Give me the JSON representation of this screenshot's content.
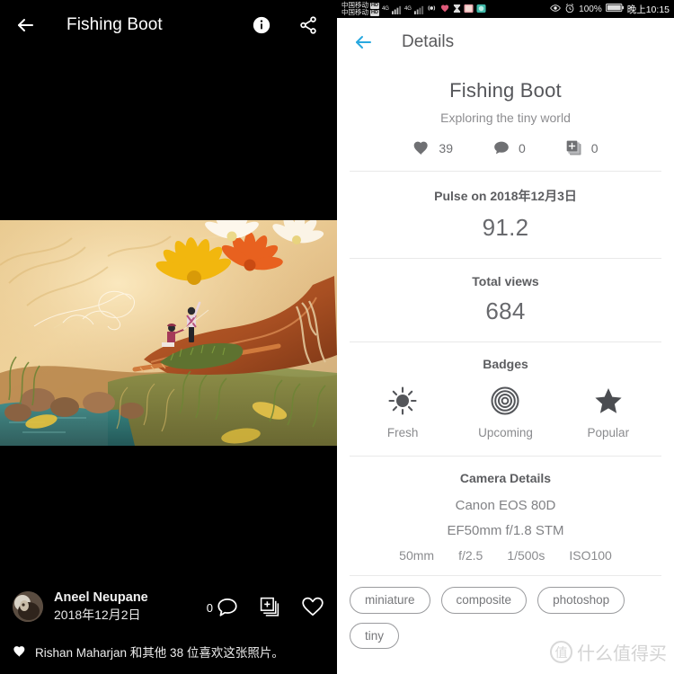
{
  "left": {
    "appbar": {
      "title": "Fishing Boot",
      "back_icon": "arrow-left-icon",
      "info_icon": "info-icon",
      "share_icon": "share-icon"
    },
    "author": {
      "name": "Aneel Neupane",
      "date": "2018年12月2日"
    },
    "actions": {
      "comment_count": "0",
      "comment_icon": "comment-icon",
      "collect_icon": "add-to-collection-icon",
      "like_icon": "heart-outline-icon"
    },
    "likes_text": "Rishan Maharjan 和其他 38 位喜欢这张照片。"
  },
  "statusbar": {
    "carrier_line1": "中国移动",
    "carrier_line2": "中国移动",
    "hd_badge": "HD",
    "net1": "4G",
    "net2": "4G",
    "hotspot": "hotspot-icon",
    "battery_percent": "100%",
    "time": "晚上10:15"
  },
  "details": {
    "appbar": {
      "back_icon": "arrow-left-icon",
      "title": "Details",
      "accent": "#29a8df"
    },
    "hero": {
      "title": "Fishing Boot",
      "subtitle": "Exploring the tiny world",
      "stats": [
        {
          "icon": "heart-filled-icon",
          "value": "39"
        },
        {
          "icon": "comment-filled-icon",
          "value": "0"
        },
        {
          "icon": "add-to-collection-icon",
          "value": "0"
        }
      ]
    },
    "pulse": {
      "label": "Pulse on 2018年12月3日",
      "value": "91.2"
    },
    "views": {
      "label": "Total views",
      "value": "684"
    },
    "badges": {
      "title": "Badges",
      "items": [
        {
          "icon": "sun-icon",
          "label": "Fresh"
        },
        {
          "icon": "target-icon",
          "label": "Upcoming"
        },
        {
          "icon": "star-icon",
          "label": "Popular"
        }
      ]
    },
    "camera": {
      "title": "Camera Details",
      "body": "Canon EOS 80D",
      "lens": "EF50mm f/1.8 STM",
      "exif": [
        "50mm",
        "f/2.5",
        "1/500s",
        "ISO100"
      ]
    },
    "tags": [
      "miniature",
      "composite",
      "photoshop",
      "tiny"
    ]
  },
  "watermark": {
    "mark": "值",
    "text": "什么值得买"
  }
}
